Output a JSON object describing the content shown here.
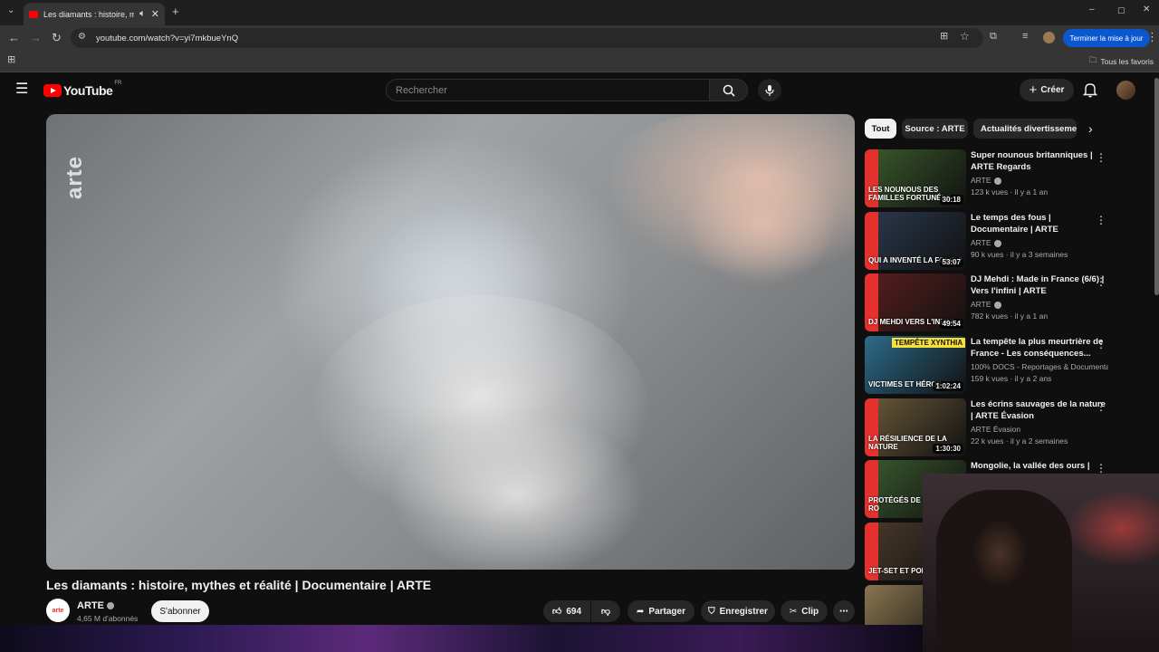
{
  "browser": {
    "tab_title": "Les diamants : histoire, mythes et réalité",
    "url": "youtube.com/watch?v=yi7mkbueYnQ",
    "update_button": "Terminer la mise à jour",
    "bookmarks_all": "Tous les favoris"
  },
  "header": {
    "logo_text": "YouTube",
    "country_code": "FR",
    "search_placeholder": "Rechercher",
    "create_label": "Créer"
  },
  "video": {
    "watermark": "arte",
    "title": "Les diamants : histoire, mythes et réalité | Documentaire | ARTE",
    "channel": "ARTE",
    "subscribers": "4,65 M d'abonnés",
    "subscribe_label": "S'abonner",
    "likes": "694",
    "share_label": "Partager",
    "save_label": "Enregistrer",
    "clip_label": "Clip"
  },
  "chips": [
    "Tout",
    "Source : ARTE",
    "Actualités divertissement"
  ],
  "recommendations": [
    {
      "title": "Super nounous britanniques | ARTE Regards",
      "channel": "ARTE",
      "meta": "123 k vues · il y a 1 an",
      "duration": "30:18",
      "caption": "Les nounous des familles fortunées",
      "thumb_color": "#3b5a2b"
    },
    {
      "title": "Le temps des fous | Documentaire | ARTE",
      "channel": "ARTE",
      "meta": "90 k vues · il y a 3 semaines",
      "duration": "53:07",
      "caption": "Qui a inventé la folie ?",
      "thumb_color": "#2c3a4e"
    },
    {
      "title": "DJ Mehdi : Made in France (6/6) | Vers l'infini | ARTE",
      "channel": "ARTE",
      "meta": "782 k vues · il y a 1 an",
      "duration": "49:54",
      "caption": "DJ Mehdi vers l'infini",
      "thumb_color": "#5a1e1e"
    },
    {
      "title": "La tempête la plus meurtrière de France - Les conséquences...",
      "channel": "100% DOCS - Reportages & Documentair...",
      "meta": "159 k vues · il y a 2 ans",
      "duration": "1:02:24",
      "caption": "Victimes et héros",
      "top_caption": "Tempête Xynthia",
      "thumb_color": "#2d6b8a"
    },
    {
      "title": "Les écrins sauvages de la nature | ARTE Évasion",
      "channel": "ARTE Évasion",
      "meta": "22 k vues · il y a 2 semaines",
      "duration": "1:30:30",
      "caption": "La résilience de la nature",
      "thumb_color": "#6b5a3a"
    },
    {
      "title": "Mongolie, la vallée des ours |",
      "channel": "",
      "meta": "",
      "duration": "",
      "caption": "Protégés de la taïga ro",
      "thumb_color": "#3a5a2e"
    },
    {
      "title": "",
      "channel": "",
      "meta": "",
      "duration": "",
      "caption": "Jet-set et porno",
      "thumb_color": "#4a3a2a"
    },
    {
      "title": "",
      "channel": "",
      "meta": "",
      "duration": "",
      "caption": "",
      "thumb_color": "#8a7550"
    }
  ]
}
